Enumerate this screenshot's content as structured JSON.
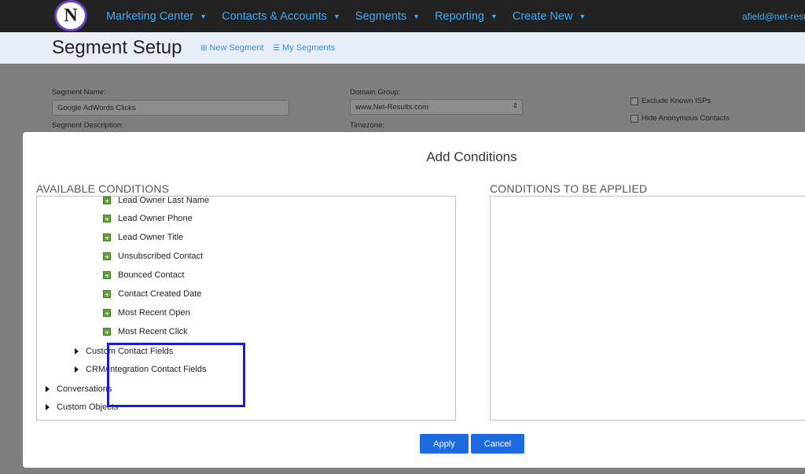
{
  "nav": {
    "logo_letter": "N",
    "items": [
      {
        "label": "Marketing Center"
      },
      {
        "label": "Contacts & Accounts"
      },
      {
        "label": "Segments"
      },
      {
        "label": "Reporting"
      },
      {
        "label": "Create New"
      }
    ],
    "user": "afield@net-resu"
  },
  "header": {
    "title": "Segment Setup",
    "new_segment": "New Segment",
    "my_segments": "My Segments"
  },
  "form": {
    "segment_name_label": "Segment Name:",
    "segment_name_value": "Google AdWords Clicks",
    "segment_description_label": "Segment Description:",
    "domain_group_label": "Domain Group:",
    "domain_group_value": "www.Net-Results.com",
    "timezone_label": "Timezone:",
    "exclude_isps": "Exclude Known ISPs",
    "hide_anonymous": "Hide Anonymous Contacts"
  },
  "modal": {
    "title": "Add Conditions",
    "available_title": "AVAILABLE CONDITIONS",
    "applied_title": "CONDITIONS TO BE APPLIED",
    "available_items": [
      "Lead Owner Last Name",
      "Lead Owner Phone",
      "Lead Owner Title",
      "Unsubscribed Contact",
      "Bounced Contact",
      "Contact Created Date",
      "Most Recent Open",
      "Most Recent Click"
    ],
    "groups": [
      "Custom Contact Fields",
      "CRM/Integration Contact Fields",
      "Conversations",
      "Custom Objects"
    ],
    "apply_label": "Apply",
    "cancel_label": "Cancel"
  },
  "colors": {
    "nav_bg": "#222222",
    "nav_link": "#3fa8f5",
    "button": "#1e6ae0",
    "highlight": "#1a1ad8",
    "plus_icon": "#5aa82f"
  }
}
